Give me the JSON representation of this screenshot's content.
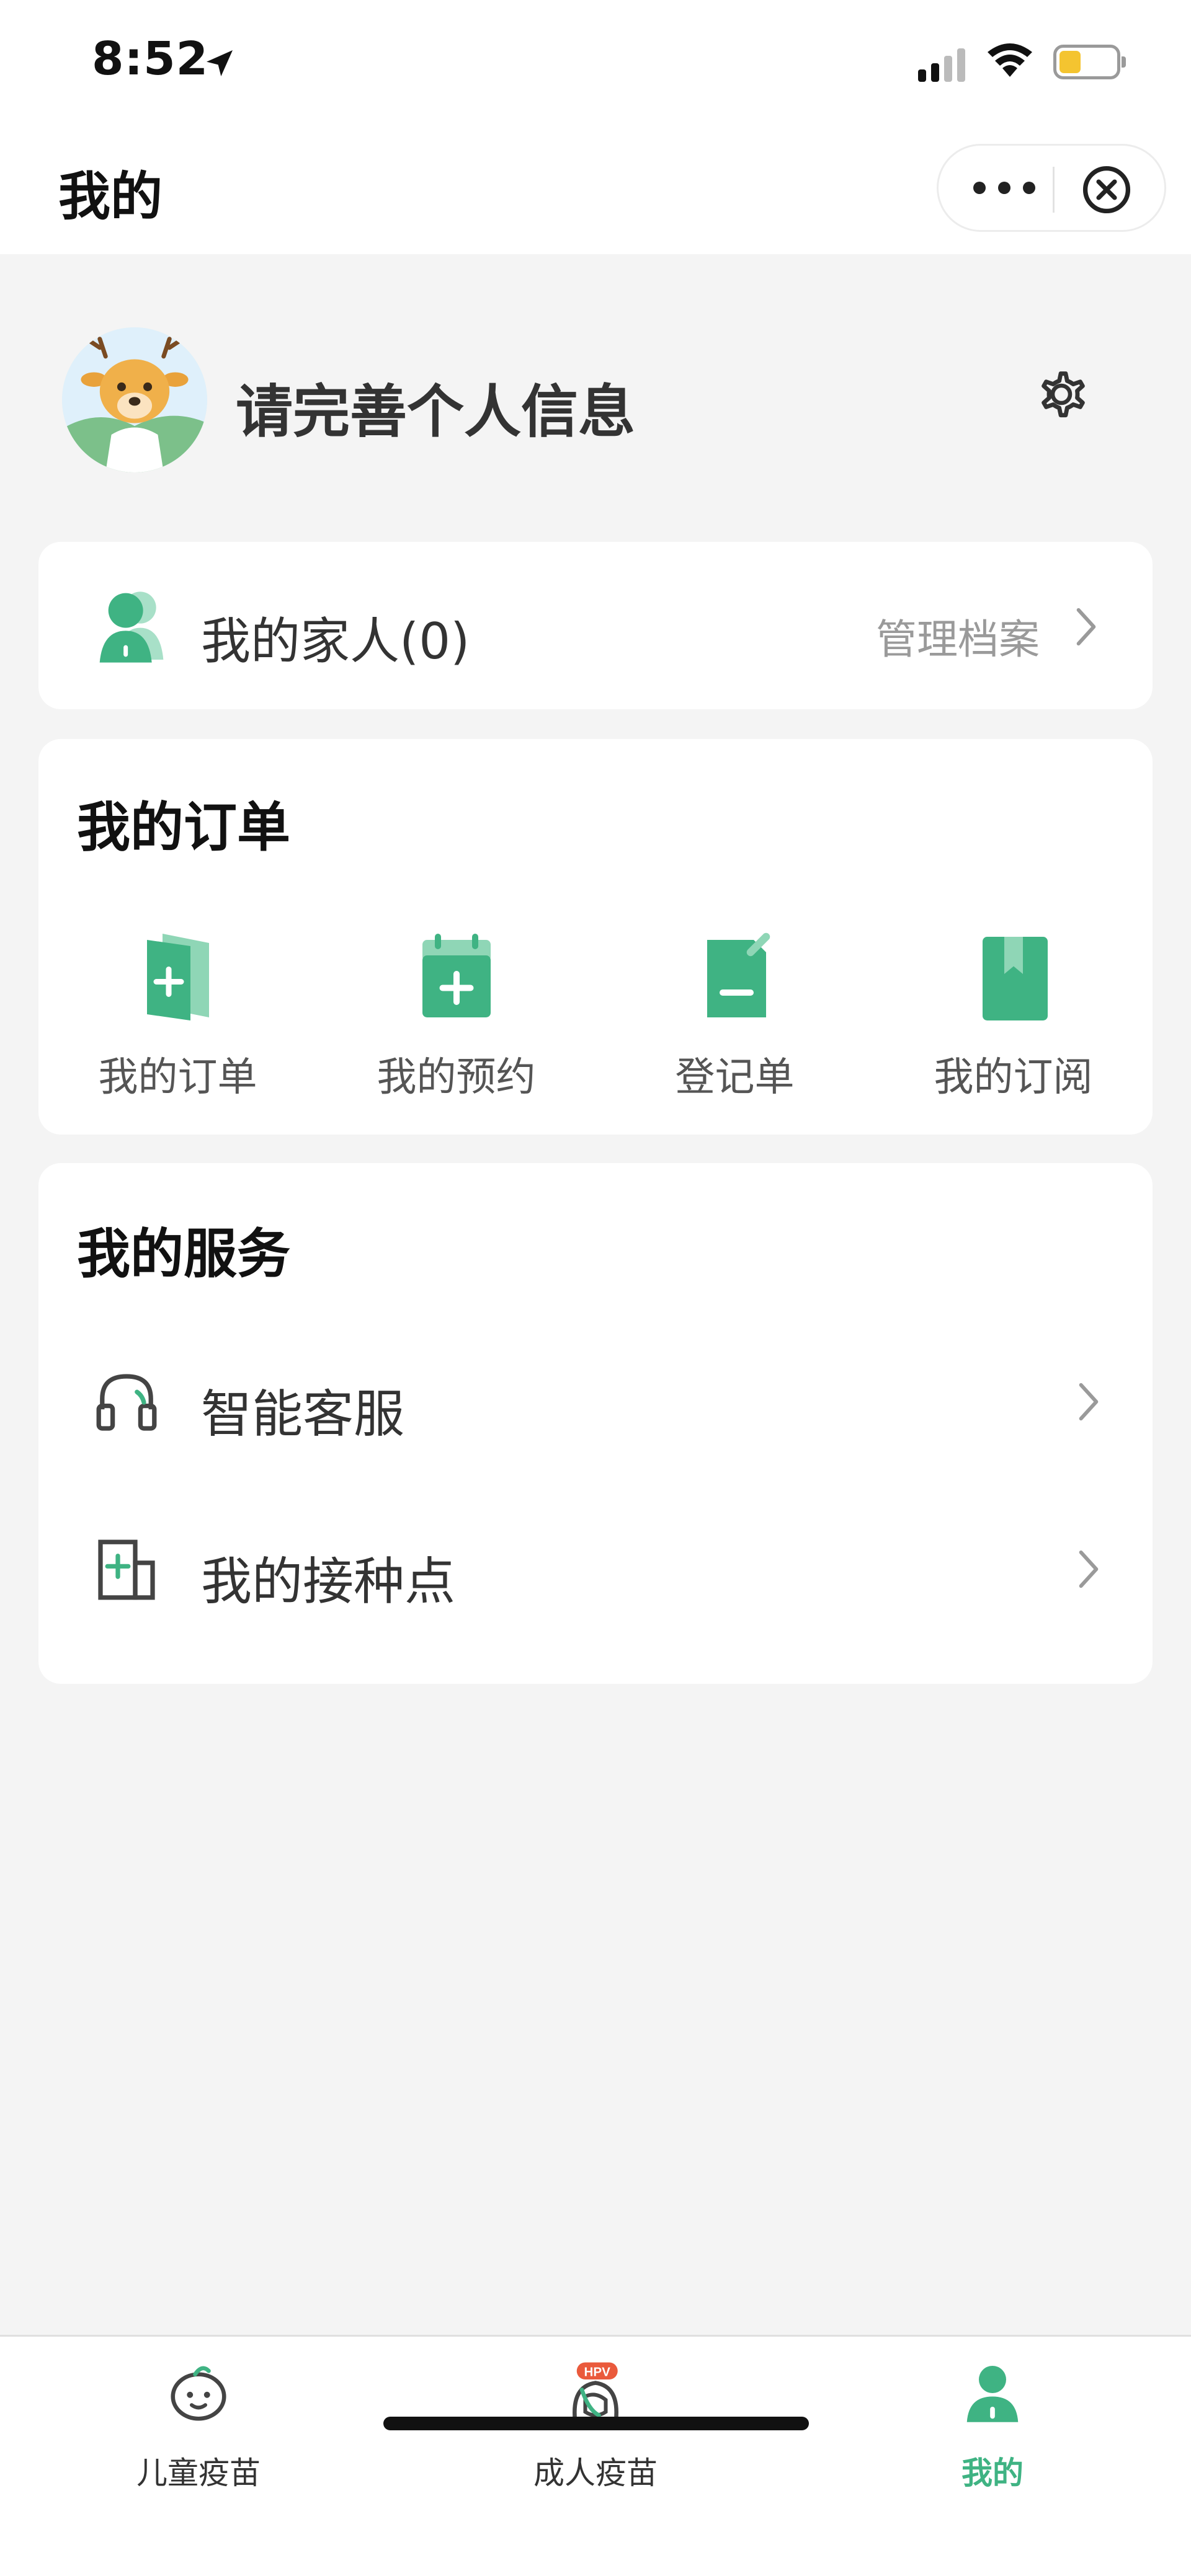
{
  "status_bar": {
    "time": "8:52"
  },
  "nav": {
    "title": "我的"
  },
  "profile": {
    "name": "请完善个人信息"
  },
  "family": {
    "label": "我的家人(0)",
    "action": "管理档案"
  },
  "orders": {
    "title": "我的订单",
    "items": [
      {
        "label": "我的订单",
        "icon": "order-doc-icon"
      },
      {
        "label": "我的预约",
        "icon": "calendar-plus-icon"
      },
      {
        "label": "登记单",
        "icon": "edit-doc-icon"
      },
      {
        "label": "我的订阅",
        "icon": "bookmark-icon"
      }
    ]
  },
  "services": {
    "title": "我的服务",
    "items": [
      {
        "label": "智能客服",
        "icon": "headset-icon"
      },
      {
        "label": "我的接种点",
        "icon": "clinic-icon"
      }
    ]
  },
  "tabbar": {
    "tabs": [
      {
        "label": "儿童疫苗",
        "icon": "baby-face-icon",
        "active": false
      },
      {
        "label": "成人疫苗",
        "icon": "adult-hpv-icon",
        "badge": "HPV",
        "active": false
      },
      {
        "label": "我的",
        "icon": "person-icon",
        "active": true
      }
    ]
  },
  "colors": {
    "accent": "#3fb383",
    "accent_light": "#8fd6b6",
    "text_muted": "#9a9a9a",
    "battery": "#f4c430"
  }
}
